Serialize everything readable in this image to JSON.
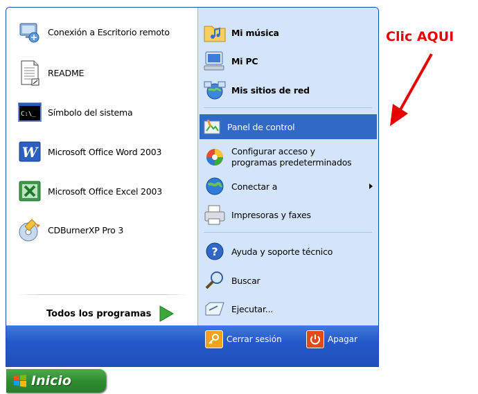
{
  "left_items": [
    {
      "label": "Conexión a Escritorio remoto",
      "icon": "remote-desktop-icon"
    },
    {
      "label": "README",
      "icon": "document-icon"
    },
    {
      "label": "Símbolo del sistema",
      "icon": "command-prompt-icon"
    },
    {
      "label": "Microsoft Office Word 2003",
      "icon": "word-icon"
    },
    {
      "label": "Microsoft Office Excel 2003",
      "icon": "excel-icon"
    },
    {
      "label": "CDBurnerXP Pro 3",
      "icon": "cdburner-icon"
    }
  ],
  "all_programs": {
    "label": "Todos los programas",
    "icon": "green-arrow-icon"
  },
  "right_items": [
    {
      "label": "Mi música",
      "icon": "music-folder-icon",
      "bold": true
    },
    {
      "label": "Mi PC",
      "icon": "my-computer-icon",
      "bold": true
    },
    {
      "label": "Mis sitios de red",
      "icon": "network-places-icon",
      "bold": true
    },
    {
      "label": "Panel de control",
      "icon": "control-panel-icon",
      "highlighted": true
    },
    {
      "label_line1": "Configurar acceso y",
      "label_line2": "programas predeterminados",
      "icon": "default-programs-icon"
    },
    {
      "label": "Conectar a",
      "icon": "connect-to-icon",
      "submenu": true
    },
    {
      "label": "Impresoras y faxes",
      "icon": "printer-icon"
    },
    {
      "label": "Ayuda y soporte técnico",
      "icon": "help-icon"
    },
    {
      "label": "Buscar",
      "icon": "search-icon"
    },
    {
      "label": "Ejecutar...",
      "icon": "run-icon"
    }
  ],
  "bottom": {
    "logoff_label": "Cerrar sesión",
    "shutdown_label": "Apagar"
  },
  "start_button": {
    "label": "Inicio"
  },
  "annotation": {
    "text": "Clic AQUI",
    "color": "#e60000"
  },
  "colors": {
    "highlight": "#316ac5",
    "right_pane": "#d3e5fa",
    "bottom_bar": "#2459c7",
    "start_button": "#2f8e30"
  }
}
